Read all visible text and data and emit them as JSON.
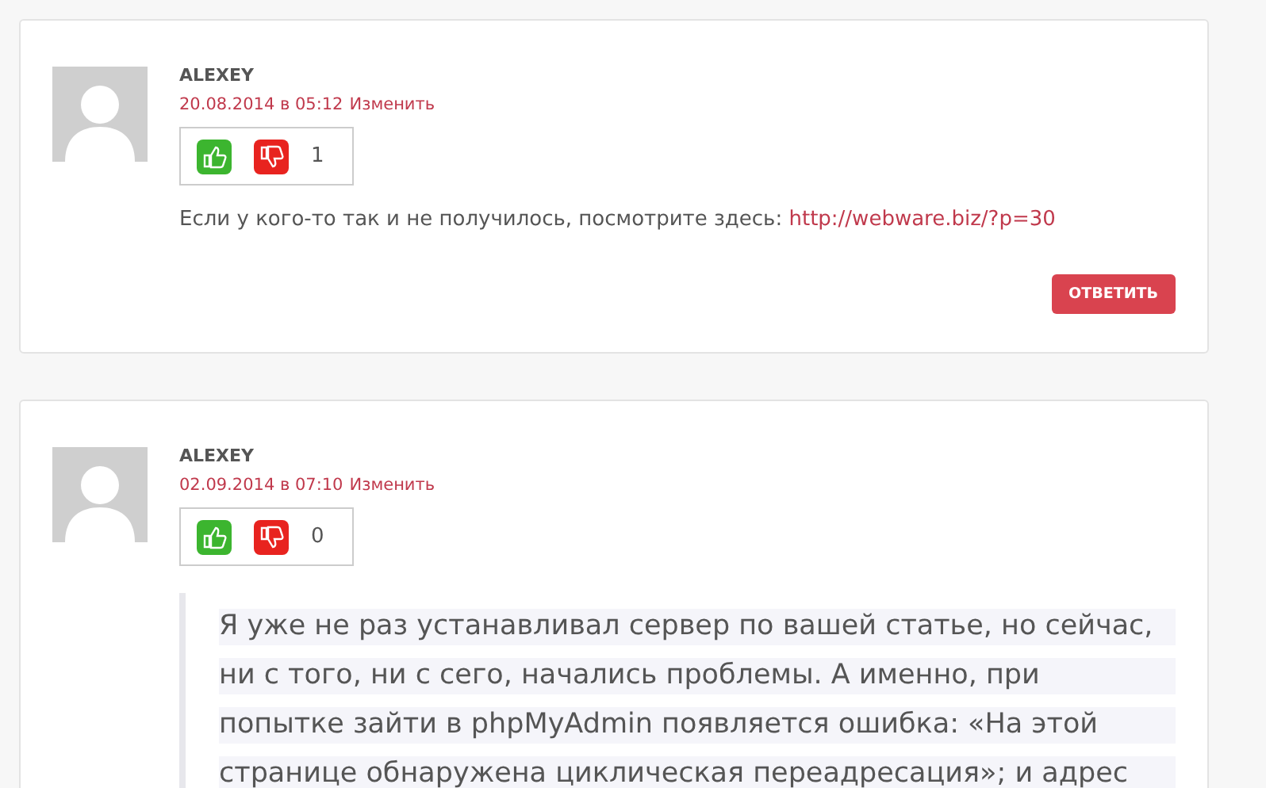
{
  "comments": [
    {
      "author": "ALEXEY",
      "date": "20.08.2014 в 05:12",
      "edit_link": "Изменить",
      "votes": "1",
      "kind": "text",
      "text": "Если у кого-то так и не получилось, посмотрите здесь: ",
      "link": "http://webware.biz/?p=30",
      "reply_button": "ОТВЕТИТЬ"
    },
    {
      "author": "ALEXEY",
      "date": "02.09.2014 в 07:10",
      "edit_link": "Изменить",
      "votes": "0",
      "kind": "quote",
      "lines": [
        "Я уже не раз устанавливал сервер по вашей статье, но сейчас,",
        "ни с того, ни с сего, начались проблемы. А именно, при",
        "попытке зайти в phpMyAdmin появляется ошибка: «На этой",
        "странице обнаружена циклическая переадресация»; и адрес"
      ]
    }
  ]
}
